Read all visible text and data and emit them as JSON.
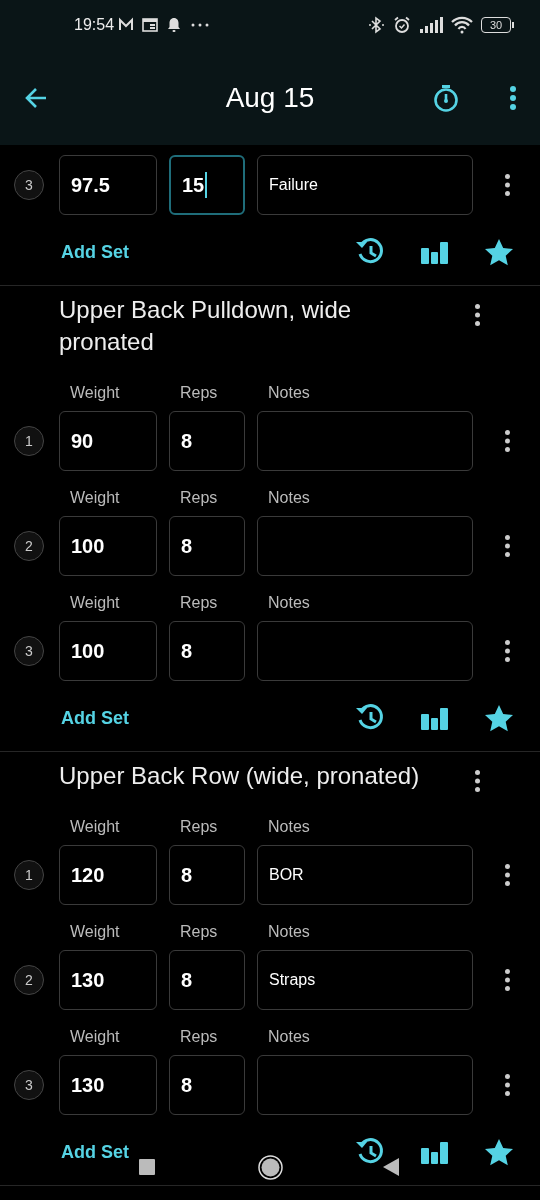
{
  "status_bar": {
    "time": "19:54",
    "battery": "30"
  },
  "app_bar": {
    "title": "Aug 15"
  },
  "exercises": [
    {
      "sets": [
        {
          "number": "3",
          "weight": "97.5",
          "reps": "15",
          "notes": "Failure",
          "reps_focused": true
        }
      ],
      "add_set": "Add Set"
    },
    {
      "name": "Upper Back Pulldown, wide pronated",
      "sets": [
        {
          "number": "1",
          "labels": [
            "Weight",
            "Reps",
            "Notes"
          ],
          "weight": "90",
          "reps": "8",
          "reps_focused": false
        },
        {
          "number": "2",
          "labels": [
            "Weight",
            "Reps",
            "Notes"
          ],
          "weight": "100",
          "reps": "8",
          "reps_focused": false
        },
        {
          "number": "3",
          "labels": [
            "Weight",
            "Reps",
            "Notes"
          ],
          "weight": "100",
          "reps": "8",
          "reps_focused": false
        }
      ],
      "add_set": "Add Set"
    },
    {
      "name": "Upper Back Row (wide, pronated)",
      "sets": [
        {
          "number": "1",
          "labels": [
            "Weight",
            "Reps",
            "Notes"
          ],
          "weight": "120",
          "reps": "8",
          "notes": "BOR",
          "reps_focused": false
        },
        {
          "number": "2",
          "labels": [
            "Weight",
            "Reps",
            "Notes"
          ],
          "weight": "130",
          "reps": "8",
          "notes": "Straps",
          "reps_focused": false
        },
        {
          "number": "3",
          "labels": [
            "Weight",
            "Reps",
            "Notes"
          ],
          "weight": "130",
          "reps": "8",
          "reps_focused": false
        }
      ],
      "add_set": "Add Set"
    }
  ]
}
